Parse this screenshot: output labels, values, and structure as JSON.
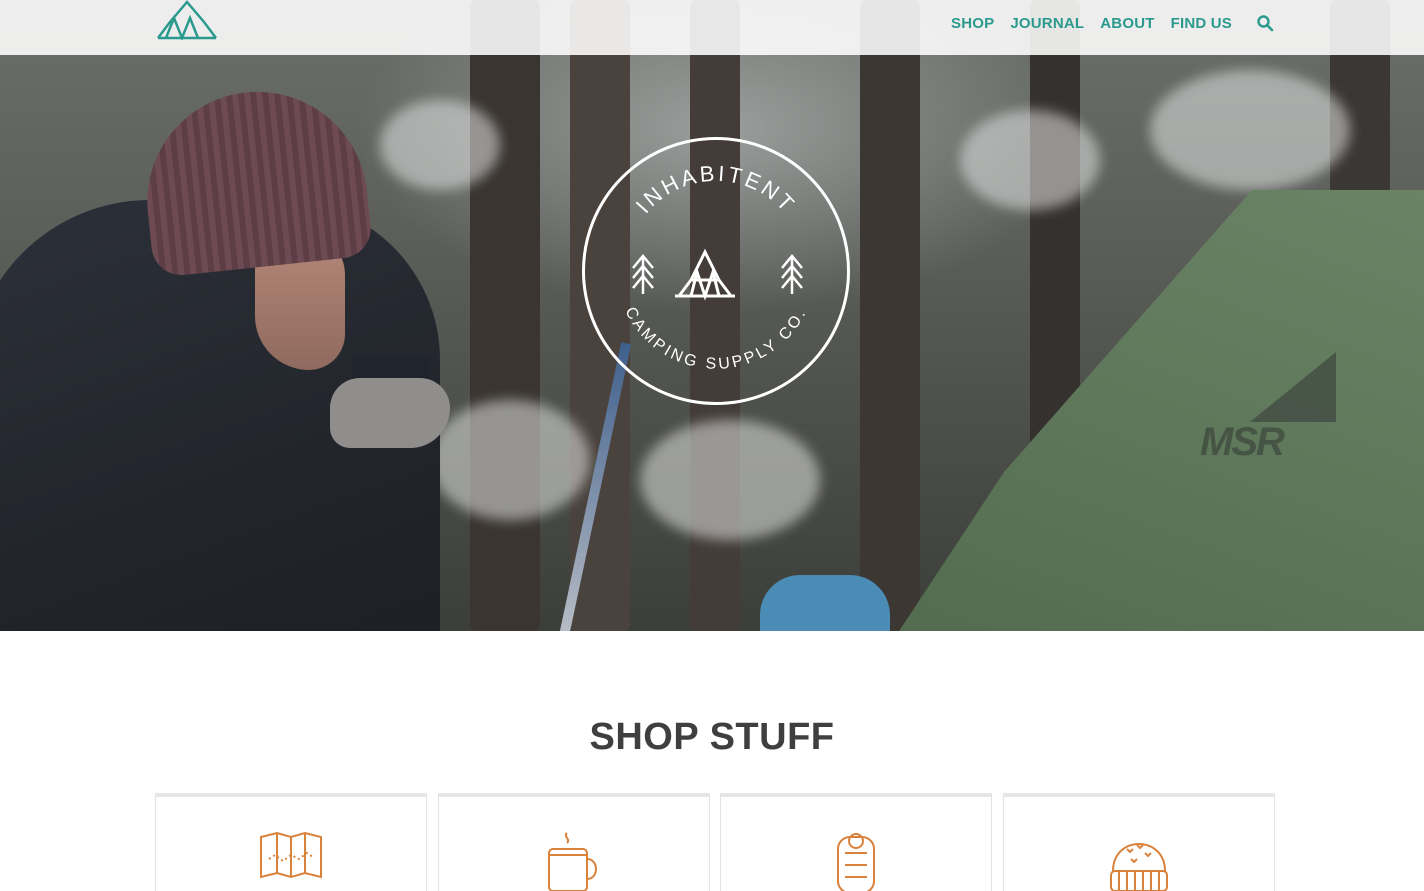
{
  "nav": {
    "items": [
      {
        "label": "SHOP"
      },
      {
        "label": "JOURNAL"
      },
      {
        "label": "ABOUT"
      },
      {
        "label": "FIND US"
      }
    ],
    "search_icon": "search-icon",
    "color": "#2a9a8e"
  },
  "badge": {
    "top_text": "INHABITENT",
    "bottom_text": "CAMPING SUPPLY CO."
  },
  "shop": {
    "title": "SHOP STUFF",
    "cards": [
      {
        "icon": "map-icon"
      },
      {
        "icon": "mug-icon"
      },
      {
        "icon": "sleeping-bag-icon"
      },
      {
        "icon": "beanie-icon"
      }
    ],
    "icon_color": "#d9823b"
  }
}
